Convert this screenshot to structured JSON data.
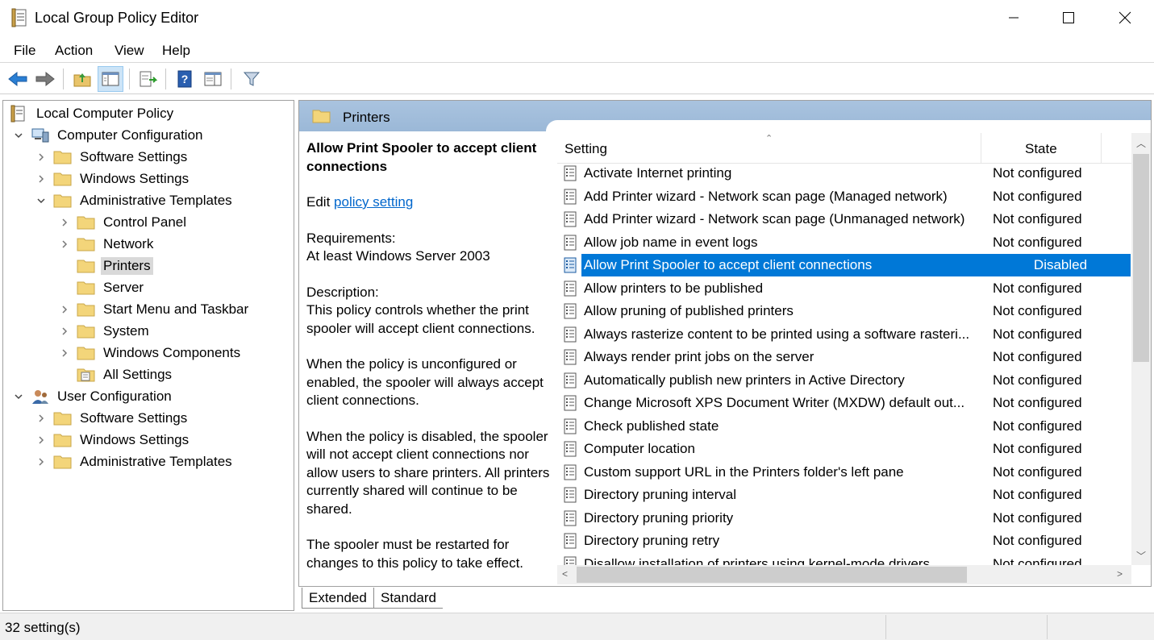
{
  "window": {
    "title": "Local Group Policy Editor",
    "minimize_glyph": "—",
    "maximize_glyph": "☐",
    "close_glyph": "✕"
  },
  "menu": [
    "File",
    "Action",
    "View",
    "Help"
  ],
  "toolbar": {
    "buttons": [
      "back-icon",
      "forward-icon",
      "up-folder-icon",
      "show-hide-tree-icon",
      "export-list-icon",
      "help-icon",
      "properties-icon",
      "filter-icon"
    ]
  },
  "tree": {
    "root": "Local Computer Policy",
    "items": [
      {
        "label": "Computer Configuration",
        "level": 1,
        "expander": "open",
        "icon": "computer-icon"
      },
      {
        "label": "Software Settings",
        "level": 2,
        "expander": "closed",
        "icon": "folder-icon"
      },
      {
        "label": "Windows Settings",
        "level": 2,
        "expander": "closed",
        "icon": "folder-icon"
      },
      {
        "label": "Administrative Templates",
        "level": 2,
        "expander": "open",
        "icon": "folder-icon"
      },
      {
        "label": "Control Panel",
        "level": 3,
        "expander": "closed",
        "icon": "folder-icon"
      },
      {
        "label": "Network",
        "level": 3,
        "expander": "closed",
        "icon": "folder-icon"
      },
      {
        "label": "Printers",
        "level": 3,
        "expander": "none",
        "icon": "folder-icon",
        "selected": true
      },
      {
        "label": "Server",
        "level": 3,
        "expander": "none",
        "icon": "folder-icon"
      },
      {
        "label": "Start Menu and Taskbar",
        "level": 3,
        "expander": "closed",
        "icon": "folder-icon"
      },
      {
        "label": "System",
        "level": 3,
        "expander": "closed",
        "icon": "folder-icon"
      },
      {
        "label": "Windows Components",
        "level": 3,
        "expander": "closed",
        "icon": "folder-icon"
      },
      {
        "label": "All Settings",
        "level": 3,
        "expander": "none",
        "icon": "all-settings-icon"
      },
      {
        "label": "User Configuration",
        "level": 1,
        "expander": "open",
        "icon": "user-icon"
      },
      {
        "label": "Software Settings",
        "level": 2,
        "expander": "closed",
        "icon": "folder-icon"
      },
      {
        "label": "Windows Settings",
        "level": 2,
        "expander": "closed",
        "icon": "folder-icon"
      },
      {
        "label": "Administrative Templates",
        "level": 2,
        "expander": "closed",
        "icon": "folder-icon"
      }
    ]
  },
  "right": {
    "header": "Printers",
    "description": {
      "title": "Allow Print Spooler to accept client connections",
      "edit_prefix": "Edit ",
      "edit_link": "policy setting",
      "requirements_label": "Requirements:",
      "requirements_value": "At least Windows Server 2003",
      "description_label": "Description:",
      "paragraphs": [
        "This policy controls whether the print spooler will accept client connections.",
        "When the policy is unconfigured or enabled, the spooler will always accept client connections.",
        "When the policy is disabled, the spooler will not accept client connections nor allow users to share printers.  All printers currently shared will continue to be shared.",
        "The spooler must be restarted for changes to this policy to take effect."
      ]
    },
    "columns": {
      "setting": "Setting",
      "state": "State"
    },
    "rows": [
      {
        "name": "Activate Internet printing",
        "state": "Not configured"
      },
      {
        "name": "Add Printer wizard - Network scan page (Managed network)",
        "state": "Not configured"
      },
      {
        "name": "Add Printer wizard - Network scan page (Unmanaged network)",
        "state": "Not configured"
      },
      {
        "name": "Allow job name in event logs",
        "state": "Not configured"
      },
      {
        "name": "Allow Print Spooler to accept client connections",
        "state": "Disabled",
        "selected": true
      },
      {
        "name": "Allow printers to be published",
        "state": "Not configured"
      },
      {
        "name": "Allow pruning of published printers",
        "state": "Not configured"
      },
      {
        "name": "Always rasterize content to be printed using a software rasteri...",
        "state": "Not configured"
      },
      {
        "name": "Always render print jobs on the server",
        "state": "Not configured"
      },
      {
        "name": "Automatically publish new printers in Active Directory",
        "state": "Not configured"
      },
      {
        "name": "Change Microsoft XPS Document Writer (MXDW) default out...",
        "state": "Not configured"
      },
      {
        "name": "Check published state",
        "state": "Not configured"
      },
      {
        "name": "Computer location",
        "state": "Not configured"
      },
      {
        "name": "Custom support URL in the Printers folder's left pane",
        "state": "Not configured"
      },
      {
        "name": "Directory pruning interval",
        "state": "Not configured"
      },
      {
        "name": "Directory pruning priority",
        "state": "Not configured"
      },
      {
        "name": "Directory pruning retry",
        "state": "Not configured"
      },
      {
        "name": "Disallow installation of printers using kernel-mode drivers",
        "state": "Not configured"
      }
    ]
  },
  "tabs": [
    "Extended",
    "Standard"
  ],
  "status": "32 setting(s)"
}
